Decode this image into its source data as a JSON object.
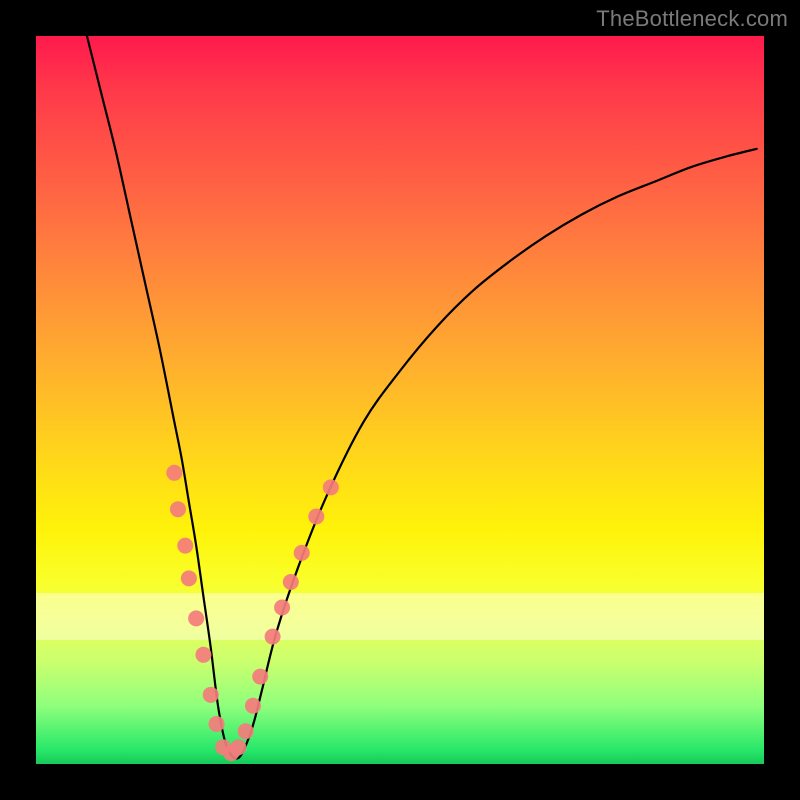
{
  "watermark": {
    "text": "TheBottleneck.com"
  },
  "colors": {
    "curve": "#000000",
    "marker_fill": "#f47c7c",
    "marker_stroke": "#f47c7c",
    "gradient_top": "#ff1a4d",
    "gradient_mid": "#ffd71a",
    "gradient_bottom": "#17c95a",
    "pale_band": "rgba(255,255,210,0.55)",
    "frame": "#000000"
  },
  "chart_data": {
    "type": "line",
    "title": "",
    "xlabel": "",
    "ylabel": "",
    "xlim": [
      0,
      100
    ],
    "ylim": [
      0,
      100
    ],
    "legend": false,
    "grid": false,
    "notes": "V-shaped curve: steep left descent, minimum near x≈25, curved rise to the right. Coral dot markers cluster near the valley on both branches. A pale horizontal band spans roughly y∈[17,24].",
    "series": [
      {
        "name": "curve",
        "color": "#000000",
        "x": [
          7,
          9,
          11,
          13,
          15,
          17,
          19,
          20,
          21,
          22,
          23,
          24,
          25,
          26,
          27,
          28,
          29,
          30,
          31,
          33,
          36,
          40,
          45,
          50,
          55,
          60,
          65,
          70,
          75,
          80,
          85,
          90,
          95,
          99
        ],
        "y": [
          100,
          92,
          84,
          75,
          66,
          57,
          47,
          42,
          36,
          30,
          23,
          16,
          8,
          3,
          1,
          1,
          3,
          6,
          10,
          18,
          27,
          37,
          47,
          54,
          60,
          65,
          69,
          72.5,
          75.5,
          78,
          80,
          82,
          83.5,
          84.5
        ]
      }
    ],
    "markers": [
      {
        "x": 19.0,
        "y": 40.0
      },
      {
        "x": 19.5,
        "y": 35.0
      },
      {
        "x": 20.5,
        "y": 30.0
      },
      {
        "x": 21.0,
        "y": 25.5
      },
      {
        "x": 22.0,
        "y": 20.0
      },
      {
        "x": 23.0,
        "y": 15.0
      },
      {
        "x": 24.0,
        "y": 9.5
      },
      {
        "x": 24.8,
        "y": 5.5
      },
      {
        "x": 25.7,
        "y": 2.3
      },
      {
        "x": 26.8,
        "y": 1.5
      },
      {
        "x": 27.8,
        "y": 2.3
      },
      {
        "x": 28.8,
        "y": 4.5
      },
      {
        "x": 29.8,
        "y": 8.0
      },
      {
        "x": 30.8,
        "y": 12.0
      },
      {
        "x": 32.5,
        "y": 17.5
      },
      {
        "x": 33.8,
        "y": 21.5
      },
      {
        "x": 35.0,
        "y": 25.0
      },
      {
        "x": 36.5,
        "y": 29.0
      },
      {
        "x": 38.5,
        "y": 34.0
      },
      {
        "x": 40.5,
        "y": 38.0
      }
    ],
    "pale_band_y": [
      17,
      24
    ]
  }
}
